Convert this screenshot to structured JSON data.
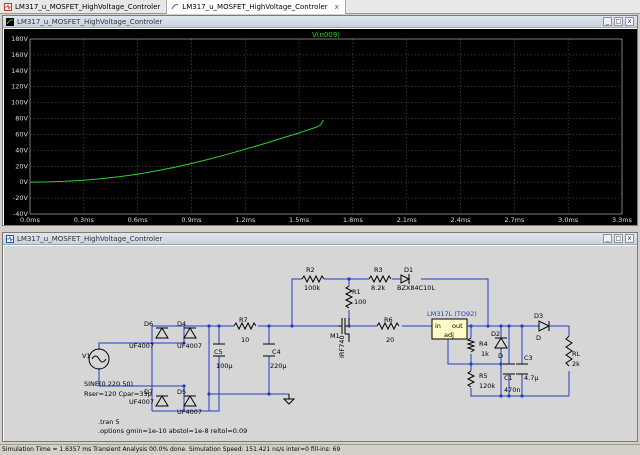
{
  "tabs": [
    {
      "label": "LM317_u_MOSFET_HighVoltage_Controler",
      "active": false
    },
    {
      "label": "LM317_u_MOSFET_HighVoltage_Controler",
      "active": true
    }
  ],
  "plot_window": {
    "title": "LM317_u_MOSFET_HighVoltage_Controler"
  },
  "schematic_window": {
    "title": "LM317_u_MOSFET_HighVoltage_Controler"
  },
  "window_buttons": {
    "minimize": "_",
    "maximize": "□",
    "close": "x"
  },
  "chart_data": {
    "type": "line",
    "title": "V(n009)",
    "series": [
      {
        "name": "V(n009)",
        "color": "#33cc33",
        "x": [
          0,
          0.1,
          0.2,
          0.3,
          0.4,
          0.5,
          0.6,
          0.7,
          0.8,
          0.9,
          1.0,
          1.1,
          1.2,
          1.3,
          1.4,
          1.5,
          1.6,
          1.62,
          1.6357
        ],
        "y": [
          0,
          0.3,
          1.2,
          2.5,
          4.5,
          7,
          10,
          14,
          18.5,
          23.5,
          29,
          35,
          41.5,
          48,
          55,
          62,
          69.5,
          72,
          78
        ]
      }
    ],
    "x_ticks": [
      "0.0ms",
      "0.3ms",
      "0.6ms",
      "0.9ms",
      "1.2ms",
      "1.5ms",
      "1.8ms",
      "2.1ms",
      "2.4ms",
      "2.7ms",
      "3.0ms",
      "3.3ms"
    ],
    "y_ticks": [
      "180V",
      "160V",
      "140V",
      "120V",
      "100V",
      "80V",
      "60V",
      "40V",
      "20V",
      "0V",
      "-20V",
      "-40V"
    ],
    "xlim": [
      0,
      3.3
    ],
    "ylim": [
      -40,
      180
    ],
    "grid": true,
    "background": "#000000"
  },
  "schematic": {
    "labels": {
      "R2": "R2",
      "R2v": "100k",
      "R3": "R3",
      "R3v": "8.2k",
      "D1": "D1",
      "D1v": "BZX84C10L",
      "R1": "R1",
      "R1v": "100",
      "R7": "R7",
      "R7v": "10",
      "R6": "R6",
      "R6v": "20",
      "M1": "M1",
      "M1v": "IRF740",
      "LM": "LM317L (TO92)",
      "in": "in",
      "out": "out",
      "adj": "adj",
      "R4": "R4",
      "R4v": "1k",
      "R5": "R5",
      "R5v": "120k",
      "D2": "D2",
      "D2v": "D",
      "D3": "D3",
      "D3v": "D",
      "C1": "C1",
      "C1v": "470n",
      "C3": "C3",
      "C3v": "4.7µ",
      "RL": "RL",
      "RLv": "2k",
      "C4": "C4",
      "C4v": "220µ",
      "C5": "C5",
      "C5v": "100µ",
      "D6": "D6",
      "D6v": "UF4007",
      "D4": "D4",
      "D4v": "UF4007",
      "D7": "D7",
      "D7v": "UF4007",
      "D5": "D5",
      "D5v": "UF4007",
      "V1": "V1",
      "sine": "SINE(0 220 50)",
      "rser": "Rser=120 Cpar=33p",
      "tran": ".tran 5",
      "opts": ".options gmin=1e-10 abstol=1e-8 reltol=0.09"
    }
  },
  "status": {
    "text": "Simulation Time = 1.6357 ms  Transient Analysis 00.0% done. Simulation Speed: 151.421 ns/s inter=0 fill-ins: 69"
  }
}
